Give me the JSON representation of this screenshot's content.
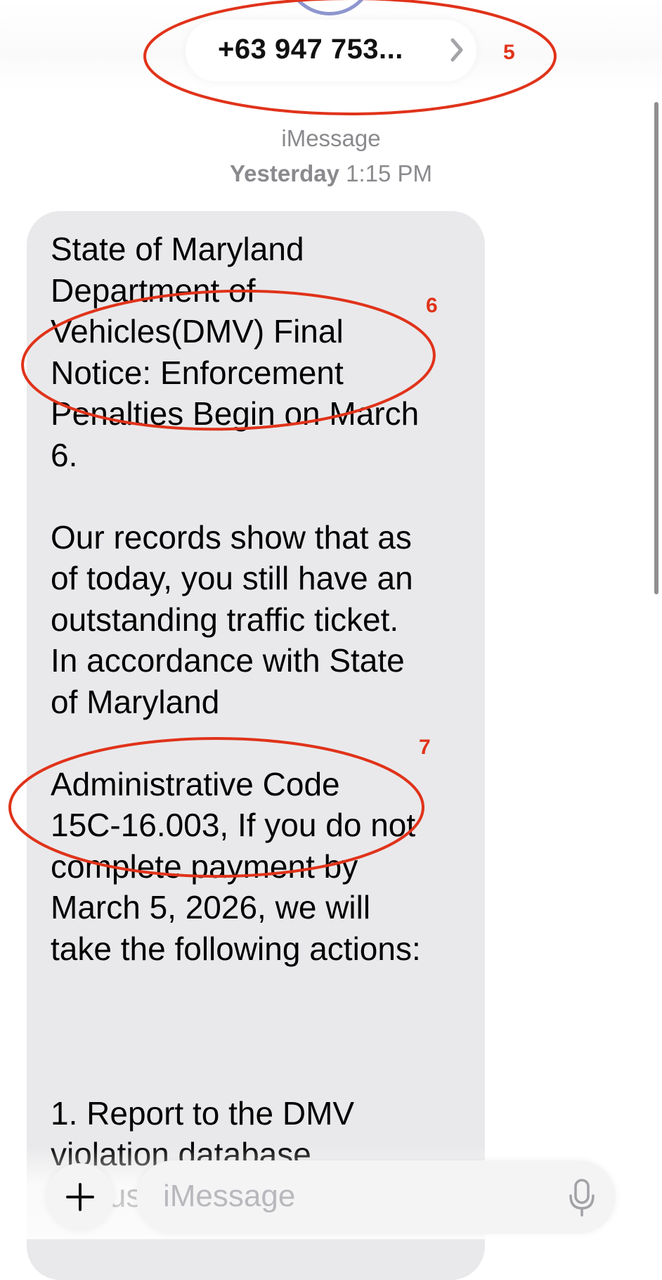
{
  "header": {
    "contact": "+63 947 753...",
    "chevron_icon": "chevron-right-icon"
  },
  "conversation": {
    "service": "iMessage",
    "timestamp_day": "Yesterday",
    "timestamp_time": "1:15 PM"
  },
  "message": {
    "text": "State of Maryland\nDepartment of\nVehicles(DMV) Final\nNotice: Enforcement\nPenalties Begin on  March\n6.\n\nOur records show that as\nof today, you still have an\noutstanding traffic ticket.\nIn accordance with State\nof Maryland\n\nAdministrative Code\n15C-16.003, If you do not\ncomplete payment by\nMarch 5, 2026, we will\ntake the following actions:\n\n\n\n1. Report to the DMV\nviolation database\n2. Suspend your vehicle"
  },
  "annotations": {
    "labels": [
      "5",
      "6",
      "7"
    ],
    "color": "#e0331a"
  },
  "compose": {
    "placeholder": "iMessage",
    "plus_icon": "plus-icon",
    "mic_icon": "microphone-icon"
  },
  "colors": {
    "bubble": "#e9e9eb",
    "meta_text": "#8a8a8e"
  }
}
